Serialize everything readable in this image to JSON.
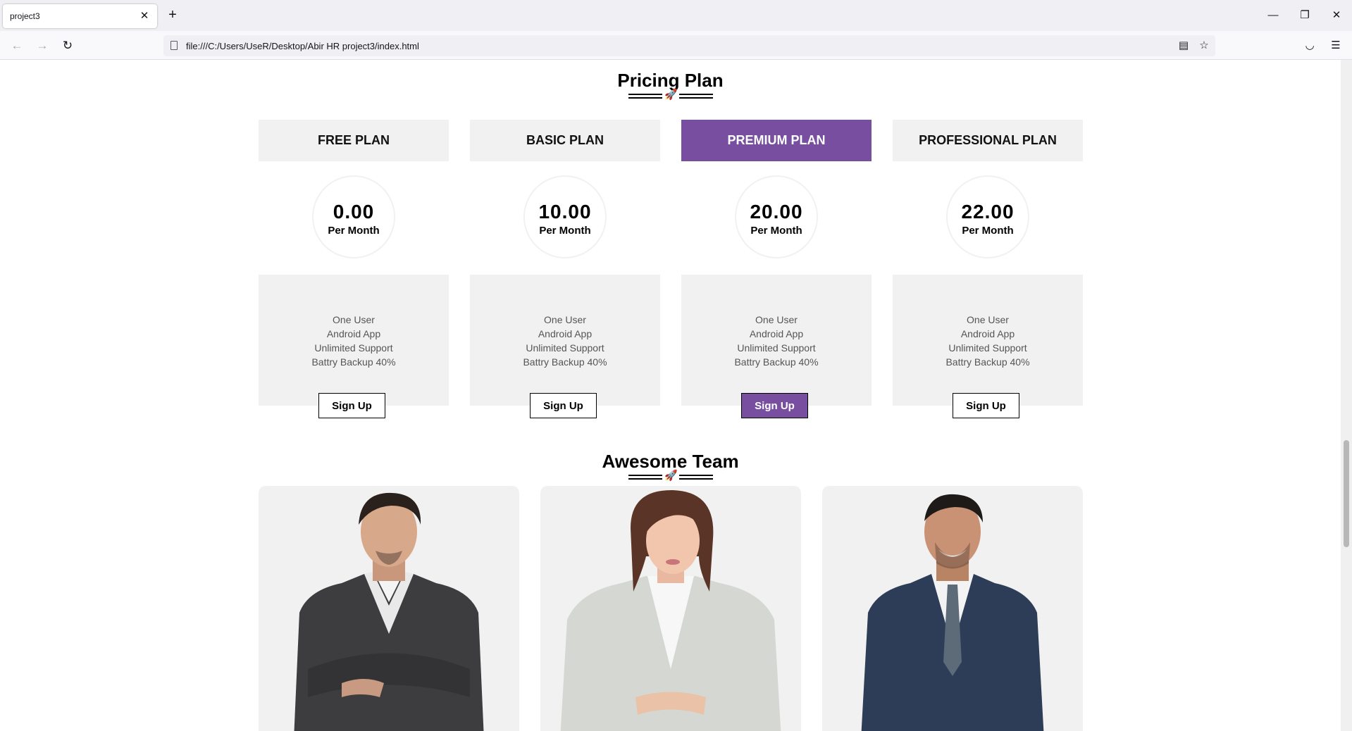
{
  "browser": {
    "tab_title": "project3",
    "url": "file:///C:/Users/UseR/Desktop/Abir HR project3/index.html"
  },
  "pricing": {
    "title": "Pricing Plan",
    "plans": [
      {
        "name": "FREE PLAN",
        "price": "0.00",
        "period": "Per Month",
        "features": [
          "One User",
          "Android App",
          "Unlimited Support",
          "Battry Backup 40%"
        ],
        "button": "Sign Up",
        "featured": false
      },
      {
        "name": "BASIC PLAN",
        "price": "10.00",
        "period": "Per Month",
        "features": [
          "One User",
          "Android App",
          "Unlimited Support",
          "Battry Backup 40%"
        ],
        "button": "Sign Up",
        "featured": false
      },
      {
        "name": "PREMIUM PLAN",
        "price": "20.00",
        "period": "Per Month",
        "features": [
          "One User",
          "Android App",
          "Unlimited Support",
          "Battry Backup 40%"
        ],
        "button": "Sign Up",
        "featured": true
      },
      {
        "name": "PROFESSIONAL PLAN",
        "price": "22.00",
        "period": "Per Month",
        "features": [
          "One User",
          "Android App",
          "Unlimited Support",
          "Battry Backup 40%"
        ],
        "button": "Sign Up",
        "featured": false
      }
    ]
  },
  "team": {
    "title": "Awesome Team",
    "members": [
      {
        "photo": "man-dark-suit-arms-crossed"
      },
      {
        "photo": "woman-light-blazer"
      },
      {
        "photo": "man-navy-suit-smiling"
      }
    ]
  },
  "colors": {
    "accent": "#774ea0",
    "panel": "#f1f1f1"
  }
}
